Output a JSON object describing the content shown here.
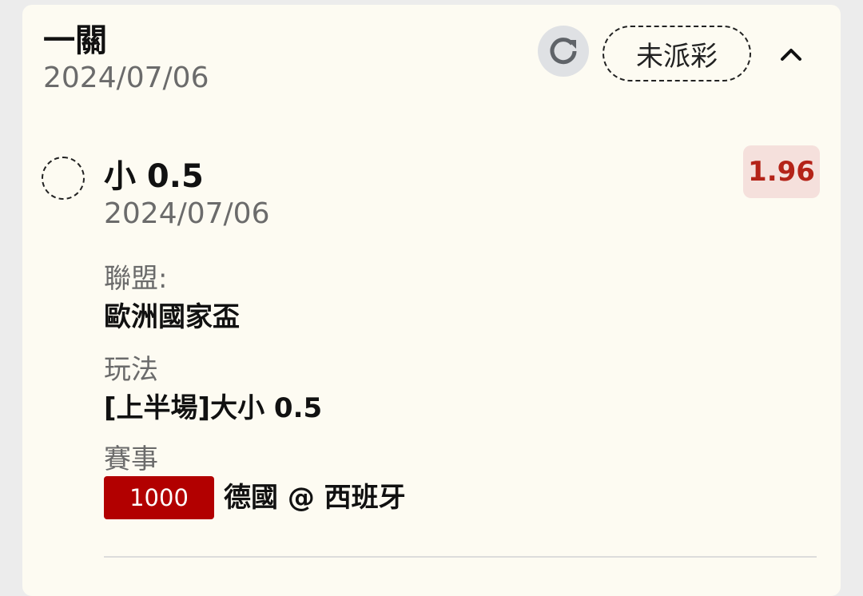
{
  "header": {
    "title": "一關",
    "date": "2024/07/06",
    "status": "未派彩",
    "refresh_icon": "refresh-icon",
    "collapse_icon": "chevron-up-icon"
  },
  "bet": {
    "selection": "小 0.5",
    "date": "2024/07/06",
    "odds": "1.96",
    "league_label": "聯盟:",
    "league_value": "歐洲國家盃",
    "market_label": "玩法",
    "market_value": "[上半場]大小 0.5",
    "match_label": "賽事",
    "match_code": "1000",
    "match_teams": "德國 @ 西班牙"
  },
  "colors": {
    "card_bg": "#fdfbf2",
    "odds_text": "#b42318",
    "odds_bg": "#f5e0dc",
    "match_code_bg": "#b20000"
  }
}
